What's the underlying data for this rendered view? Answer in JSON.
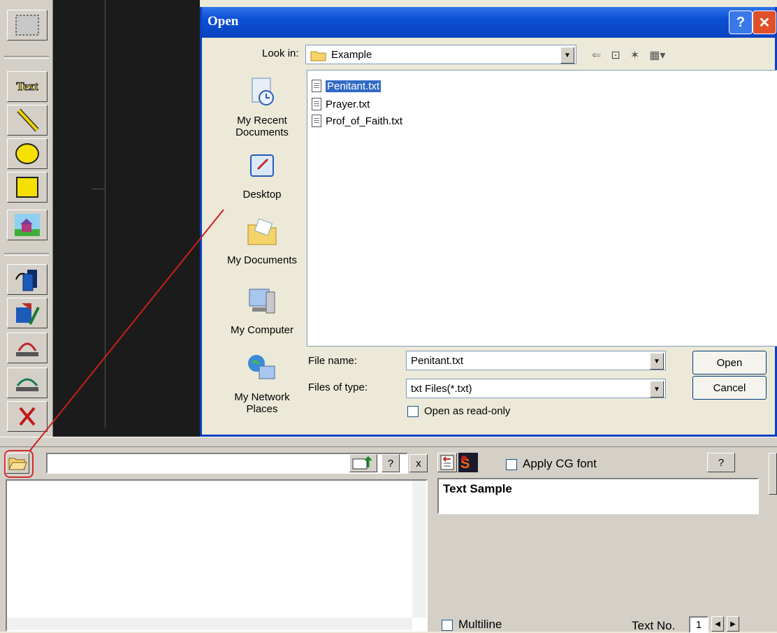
{
  "toolbar": {
    "items": [
      "select-tool",
      "text-tool",
      "line-tool",
      "ellipse-tool",
      "rectangle-tool",
      "picture-tool",
      "bring-front-tool",
      "edit-tool",
      "rotate-left-tool",
      "arc-tool",
      "delete-tool"
    ],
    "text_label": "Text"
  },
  "dialog": {
    "title": "Open",
    "help_btn": "?",
    "close_btn": "✕",
    "look_in_label": "Look in:",
    "look_in_value": "Example",
    "places": [
      {
        "label": "My Recent Documents"
      },
      {
        "label": "Desktop"
      },
      {
        "label": "My Documents"
      },
      {
        "label": "My Computer"
      },
      {
        "label": "My Network Places"
      }
    ],
    "files": [
      "Penitant.txt",
      "Prayer.txt",
      "Prof_of_Faith.txt"
    ],
    "selected_file": "Penitant.txt",
    "file_name_label": "File name:",
    "file_name_value": "Penitant.txt",
    "file_type_label": "Files of type:",
    "file_type_value": "txt Files(*.txt)",
    "readonly_label": "Open as read-only",
    "open_btn": "Open",
    "cancel_btn": "Cancel"
  },
  "bottom": {
    "help_q": "?",
    "close_x": "x",
    "apply_cg_font": "Apply CG font",
    "right_help": "?",
    "text_sample": "Text Sample",
    "multiline": "Multiline",
    "text_no_label": "Text No.",
    "text_no_value": "1"
  },
  "colors": {
    "accent": "#0a44c0",
    "annotation": "#cc1e1e",
    "selection": "#316ac5"
  }
}
